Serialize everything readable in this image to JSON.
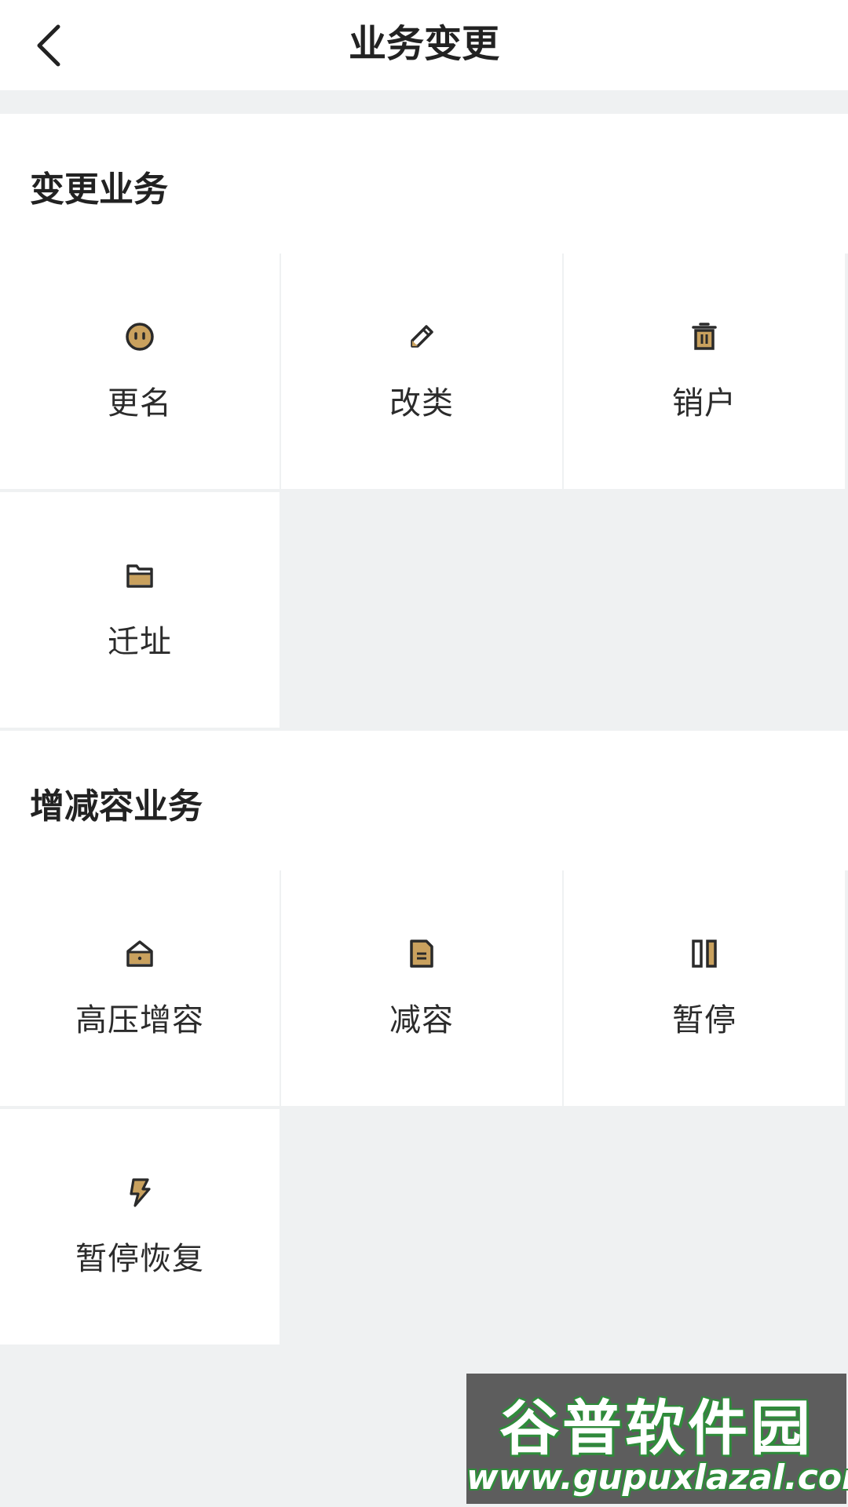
{
  "header": {
    "title": "业务变更"
  },
  "sections": [
    {
      "title": "变更业务",
      "items": [
        {
          "label": "更名",
          "icon": "face-icon"
        },
        {
          "label": "改类",
          "icon": "pencil-icon"
        },
        {
          "label": "销户",
          "icon": "trash-icon"
        },
        {
          "label": "迁址",
          "icon": "folder-icon"
        }
      ]
    },
    {
      "title": "增减容业务",
      "items": [
        {
          "label": "高压增容",
          "icon": "house-icon"
        },
        {
          "label": "减容",
          "icon": "document-icon"
        },
        {
          "label": "暂停",
          "icon": "pause-icon"
        },
        {
          "label": "暂停恢复",
          "icon": "lightning-icon"
        }
      ]
    }
  ],
  "watermark": {
    "title": "谷普软件园",
    "url": "www.gupuxlazal.com"
  },
  "colors": {
    "icon_accent": "#c9a15e",
    "icon_stroke": "#2a2a2a",
    "background": "#eff1f2"
  }
}
